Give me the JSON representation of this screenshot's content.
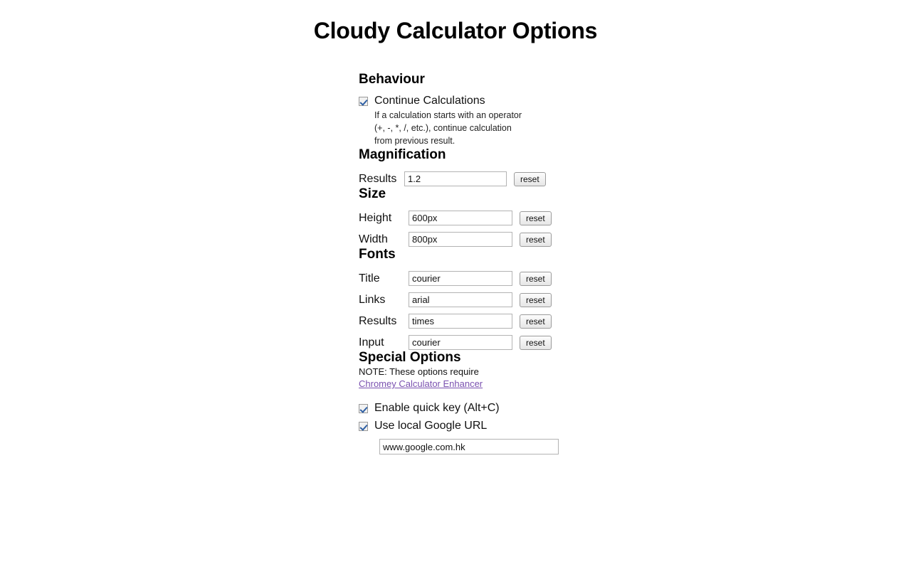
{
  "page": {
    "title": "Cloudy Calculator Options"
  },
  "behaviour": {
    "heading": "Behaviour",
    "continue_calculations": {
      "label": "Continue Calculations",
      "checked": true,
      "help_lines": [
        "If a calculation starts with an operator",
        "(+, -, *, /, etc.), continue calculation",
        "from previous result."
      ]
    }
  },
  "magnification": {
    "heading": "Magnification",
    "fields": [
      {
        "label": "Results",
        "value": "1.2",
        "reset_label": "reset"
      }
    ]
  },
  "size": {
    "heading": "Size",
    "fields": [
      {
        "label": "Height",
        "value": "600px",
        "reset_label": "reset"
      },
      {
        "label": "Width",
        "value": "800px",
        "reset_label": "reset"
      }
    ]
  },
  "fonts": {
    "heading": "Fonts",
    "fields": [
      {
        "label": "Title",
        "value": "courier",
        "reset_label": "reset"
      },
      {
        "label": "Links",
        "value": "arial",
        "reset_label": "reset"
      },
      {
        "label": "Results",
        "value": "times",
        "reset_label": "reset"
      },
      {
        "label": "Input",
        "value": "courier",
        "reset_label": "reset"
      }
    ]
  },
  "special_options": {
    "heading": "Special Options",
    "note_text": "NOTE: These options require",
    "note_link": "Chromey Calculator Enhancer",
    "link_color": "#7a51b0",
    "quick_key": {
      "label": "Enable quick key (Alt+C)",
      "checked": true
    },
    "local_google_url": {
      "label": "Use local Google URL",
      "checked": true,
      "value": "www.google.com.hk"
    }
  }
}
